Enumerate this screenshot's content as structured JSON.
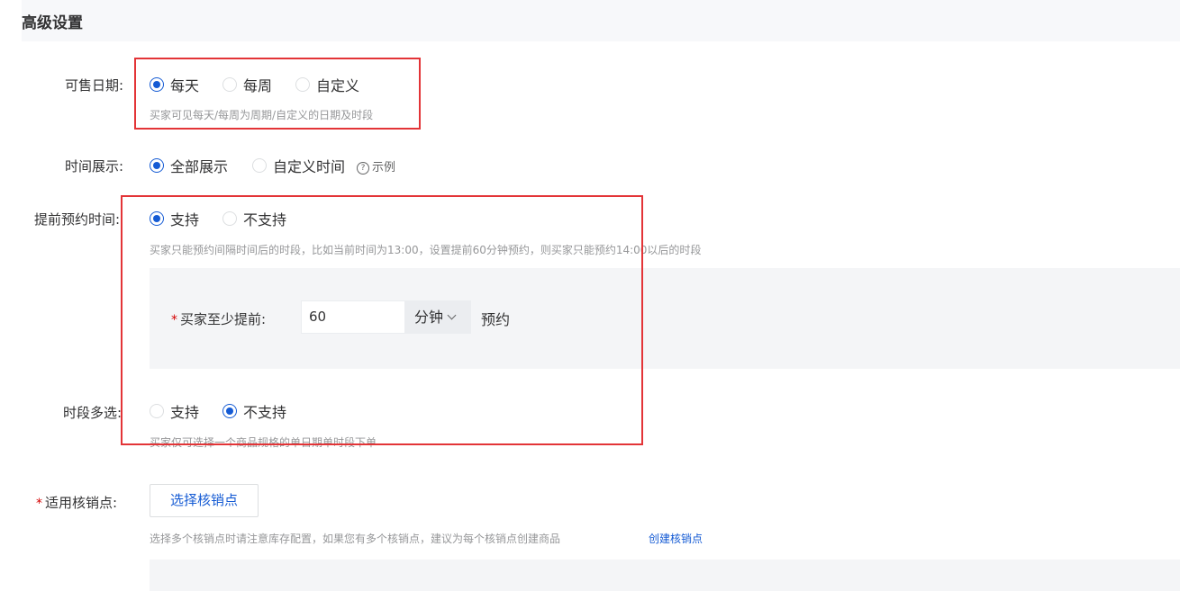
{
  "section": {
    "title": "高级设置"
  },
  "sale_date": {
    "label": "可售日期:",
    "options": [
      "每天",
      "每周",
      "自定义"
    ],
    "selected": "每天",
    "hint": "买家可见每天/每周为周期/自定义的日期及时段"
  },
  "time_display": {
    "label": "时间展示:",
    "options": [
      "全部展示",
      "自定义时间"
    ],
    "selected": "全部展示",
    "example_icon": "question-circle-icon",
    "example_label": "示例"
  },
  "advance_booking": {
    "label": "提前预约时间:",
    "options": [
      "支持",
      "不支持"
    ],
    "selected": "支持",
    "hint": "买家只能预约间隔时间后的时段，比如当前时间为13:00，设置提前60分钟预约，则买家只能预约14:00以后的时段",
    "min_advance_label": "买家至少提前:",
    "min_advance_value": "60",
    "unit": "分钟",
    "suffix": "预约"
  },
  "multi_slot": {
    "label": "时段多选:",
    "options": [
      "支持",
      "不支持"
    ],
    "selected": "不支持",
    "hint": "买家仅可选择一个商品规格的单日期单时段下单"
  },
  "redemption": {
    "required_mark": "*",
    "label": "适用核销点:",
    "button_label": "选择核销点",
    "hint": "选择多个核销点时请注意库存配置，如果您有多个核销点，建议为每个核销点创建商品",
    "create_link": "创建核销点"
  },
  "colors": {
    "accent": "#155bd4",
    "highlight_box": "#e33437",
    "panel_bg": "#f4f5f7"
  }
}
